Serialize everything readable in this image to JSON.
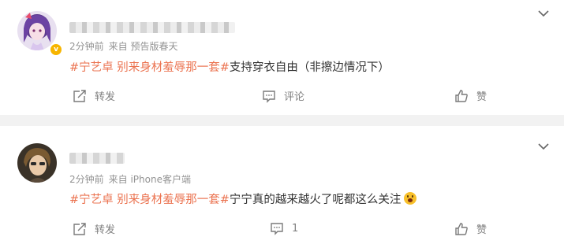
{
  "comments": [
    {
      "time": "2分钟前",
      "source": "来自 预告版春天",
      "hashtag": "#宁艺卓 别来身材羞辱那一套#",
      "text": "支持穿衣自由（非擦边情况下）",
      "repost_label": "转发",
      "comment_label": "评论",
      "like_label": "赞",
      "verified_badge": "v"
    },
    {
      "time": "2分钟前",
      "source": "来自 iPhone客户端",
      "hashtag": "#宁艺卓 别来身材羞辱那一套#",
      "text": "宁宁真的越来越火了呢都这么关注",
      "repost_label": "转发",
      "comment_count": "1",
      "like_label": "赞"
    }
  ],
  "colors": {
    "hashtag": "#eb7350",
    "meta_text": "#939393",
    "action_text": "#808080",
    "divider": "#f2f2f2"
  },
  "icons": [
    "chevron-down-icon",
    "repost-icon",
    "comment-icon",
    "like-icon",
    "surprised-emoji-icon"
  ]
}
